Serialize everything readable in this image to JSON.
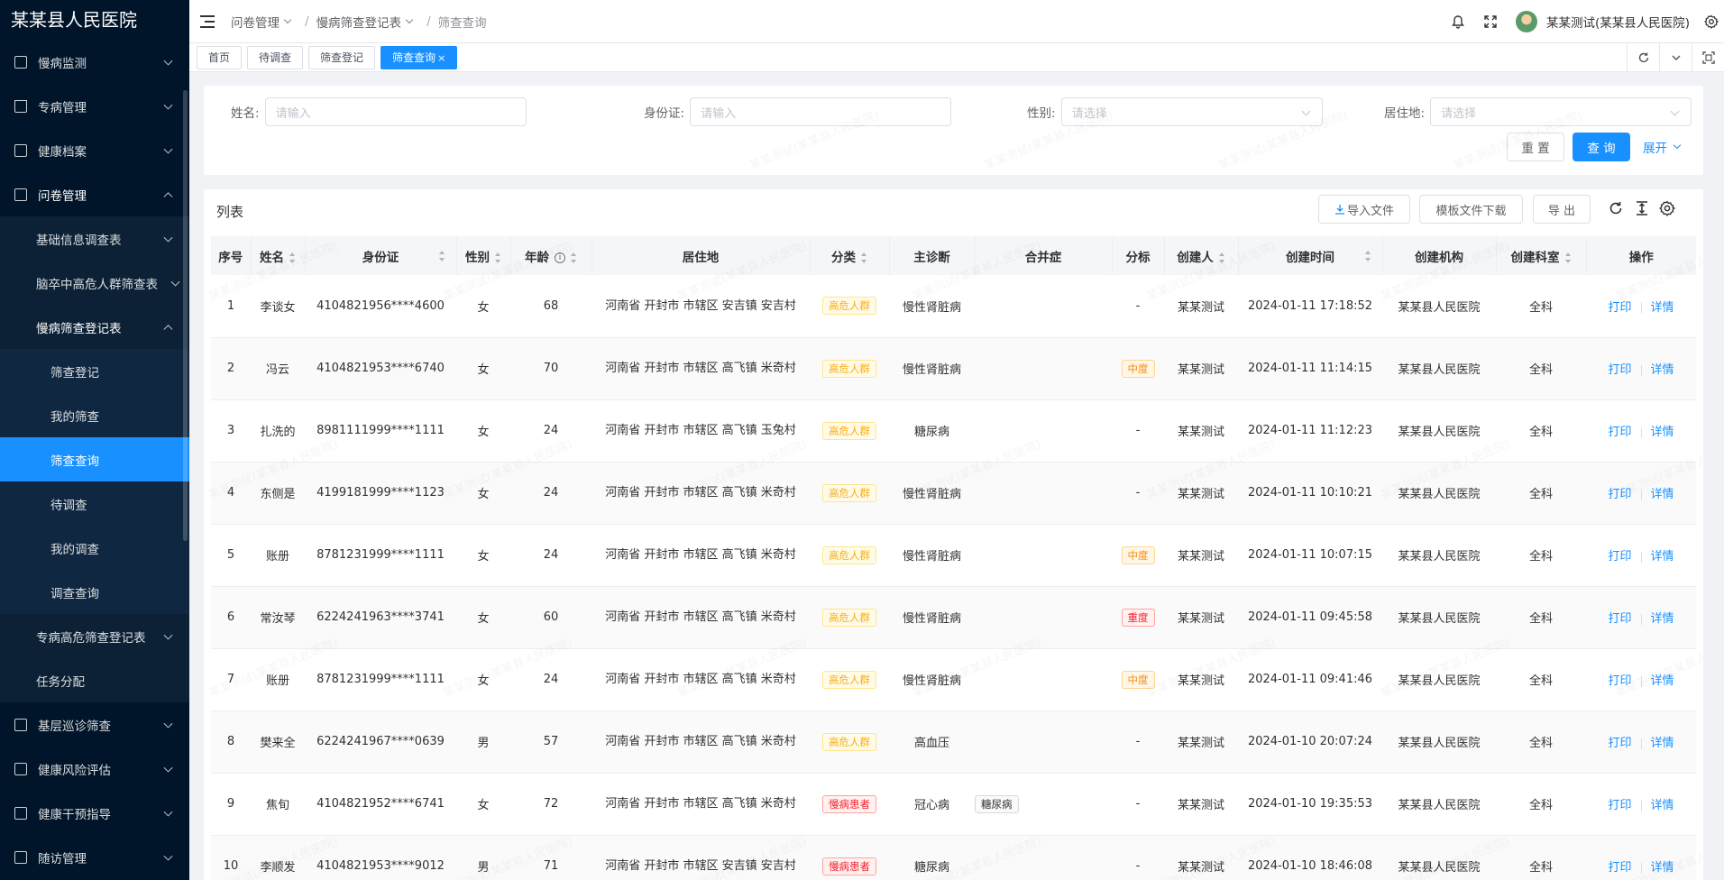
{
  "app": {
    "title": "某某县人民医院"
  },
  "sidebar": {
    "items": [
      {
        "label": "慢病监测",
        "icon": "monitor-icon",
        "open": false
      },
      {
        "label": "专病管理",
        "icon": "home-icon",
        "open": false
      },
      {
        "label": "健康档案",
        "icon": "file-icon",
        "open": false
      },
      {
        "label": "问卷管理",
        "icon": "survey-icon",
        "open": true
      }
    ],
    "sub": {
      "basic": "基础信息调查表",
      "stroke": "脑卒中高危人群筛查表",
      "chronic": "慢病筛查登记表",
      "chronic_children": [
        "筛查登记",
        "我的筛查",
        "筛查查询",
        "待调查",
        "我的调查",
        "调查查询"
      ],
      "special": "专病高危筛查登记表",
      "task": "任务分配"
    },
    "bottom_items": [
      {
        "label": "基层巡诊筛查",
        "icon": "clipboard-icon"
      },
      {
        "label": "健康风险评估",
        "icon": "assessment-icon"
      },
      {
        "label": "健康干预指导",
        "icon": "guide-icon"
      },
      {
        "label": "随访管理",
        "icon": "followup-icon"
      }
    ]
  },
  "header": {
    "breadcrumb": [
      "问卷管理",
      "慢病筛查登记表",
      "筛查查询"
    ],
    "user": "某某测试(某某县人民医院)"
  },
  "tabs": [
    {
      "label": "首页"
    },
    {
      "label": "待调查"
    },
    {
      "label": "筛查登记"
    },
    {
      "label": "筛查查询",
      "close": "×"
    }
  ],
  "filter": {
    "name_label": "姓名:",
    "name_placeholder": "请输入",
    "id_label": "身份证:",
    "id_placeholder": "请输入",
    "gender_label": "性别:",
    "gender_placeholder": "请选择",
    "residence_label": "居住地:",
    "residence_placeholder": "请选择",
    "reset": "重 置",
    "search": "查 询",
    "expand": "展开"
  },
  "list": {
    "title": "列表",
    "import": "导入文件",
    "template": "模板文件下载",
    "export": "导 出",
    "columns": [
      "序号",
      "姓名",
      "身份证",
      "性别",
      "年龄",
      "居住地",
      "分类",
      "主诊断",
      "合并症",
      "分标",
      "创建人",
      "创建时间",
      "创建机构",
      "创建科室",
      "操作"
    ],
    "print_label": "打印",
    "detail_label": "详情",
    "rows": [
      {
        "no": "1",
        "name": "李谈女",
        "id": "4104821956****4600",
        "gender": "女",
        "age": "68",
        "addr": "河南省 开封市 市辖区 安吉镇 安吉村",
        "cat": "高危人群",
        "diag": "慢性肾脏病",
        "comp": "",
        "level": "-",
        "creator": "某某测试",
        "time": "2024-01-11 17:18:52",
        "org": "某某县人民医院",
        "dept": "全科"
      },
      {
        "no": "2",
        "name": "冯云",
        "id": "4104821953****6740",
        "gender": "女",
        "age": "70",
        "addr": "河南省 开封市 市辖区 高飞镇 米奇村",
        "cat": "高危人群",
        "diag": "慢性肾脏病",
        "comp": "",
        "level": "中度",
        "creator": "某某测试",
        "time": "2024-01-11 11:14:15",
        "org": "某某县人民医院",
        "dept": "全科"
      },
      {
        "no": "3",
        "name": "扎洗的",
        "id": "8981111999****1111",
        "gender": "女",
        "age": "24",
        "addr": "河南省 开封市 市辖区 高飞镇 玉兔村",
        "cat": "高危人群",
        "diag": "糖尿病",
        "comp": "",
        "level": "-",
        "creator": "某某测试",
        "time": "2024-01-11 11:12:23",
        "org": "某某县人民医院",
        "dept": "全科"
      },
      {
        "no": "4",
        "name": "东侧是",
        "id": "4199181999****1123",
        "gender": "女",
        "age": "24",
        "addr": "河南省 开封市 市辖区 高飞镇 米奇村",
        "cat": "高危人群",
        "diag": "慢性肾脏病",
        "comp": "",
        "level": "-",
        "creator": "某某测试",
        "time": "2024-01-11 10:10:21",
        "org": "某某县人民医院",
        "dept": "全科"
      },
      {
        "no": "5",
        "name": "账册",
        "id": "8781231999****1111",
        "gender": "女",
        "age": "24",
        "addr": "河南省 开封市 市辖区 高飞镇 米奇村",
        "cat": "高危人群",
        "diag": "慢性肾脏病",
        "comp": "",
        "level": "中度",
        "creator": "某某测试",
        "time": "2024-01-11 10:07:15",
        "org": "某某县人民医院",
        "dept": "全科"
      },
      {
        "no": "6",
        "name": "常汝琴",
        "id": "6224241963****3741",
        "gender": "女",
        "age": "60",
        "addr": "河南省 开封市 市辖区 高飞镇 米奇村",
        "cat": "高危人群",
        "diag": "慢性肾脏病",
        "comp": "",
        "level": "重度",
        "creator": "某某测试",
        "time": "2024-01-11 09:45:58",
        "org": "某某县人民医院",
        "dept": "全科"
      },
      {
        "no": "7",
        "name": "账册",
        "id": "8781231999****1111",
        "gender": "女",
        "age": "24",
        "addr": "河南省 开封市 市辖区 高飞镇 米奇村",
        "cat": "高危人群",
        "diag": "慢性肾脏病",
        "comp": "",
        "level": "中度",
        "creator": "某某测试",
        "time": "2024-01-11 09:41:46",
        "org": "某某县人民医院",
        "dept": "全科"
      },
      {
        "no": "8",
        "name": "樊来全",
        "id": "6224241967****0639",
        "gender": "男",
        "age": "57",
        "addr": "河南省 开封市 市辖区 高飞镇 米奇村",
        "cat": "高危人群",
        "diag": "高血压",
        "comp": "",
        "level": "-",
        "creator": "某某测试",
        "time": "2024-01-10 20:07:24",
        "org": "某某县人民医院",
        "dept": "全科"
      },
      {
        "no": "9",
        "name": "焦旬",
        "id": "4104821952****6741",
        "gender": "女",
        "age": "72",
        "addr": "河南省 开封市 市辖区 高飞镇 米奇村",
        "cat": "慢病患者",
        "diag": "冠心病",
        "comp": "糖尿病",
        "level": "-",
        "creator": "某某测试",
        "time": "2024-01-10 19:35:53",
        "org": "某某县人民医院",
        "dept": "全科"
      },
      {
        "no": "10",
        "name": "李顺发",
        "id": "4104821953****9012",
        "gender": "男",
        "age": "71",
        "addr": "河南省 开封市 市辖区 安吉镇 安吉村",
        "cat": "慢病患者",
        "diag": "糖尿病",
        "comp": "",
        "level": "-",
        "creator": "某某测试",
        "time": "2024-01-10 18:46:08",
        "org": "某某县人民医院",
        "dept": "全科"
      }
    ]
  },
  "colors": {
    "primary": "#1890ff",
    "sidebar": "#001529",
    "warn": "#faad14",
    "danger": "#f5222d",
    "orange": "#fa8c16"
  }
}
